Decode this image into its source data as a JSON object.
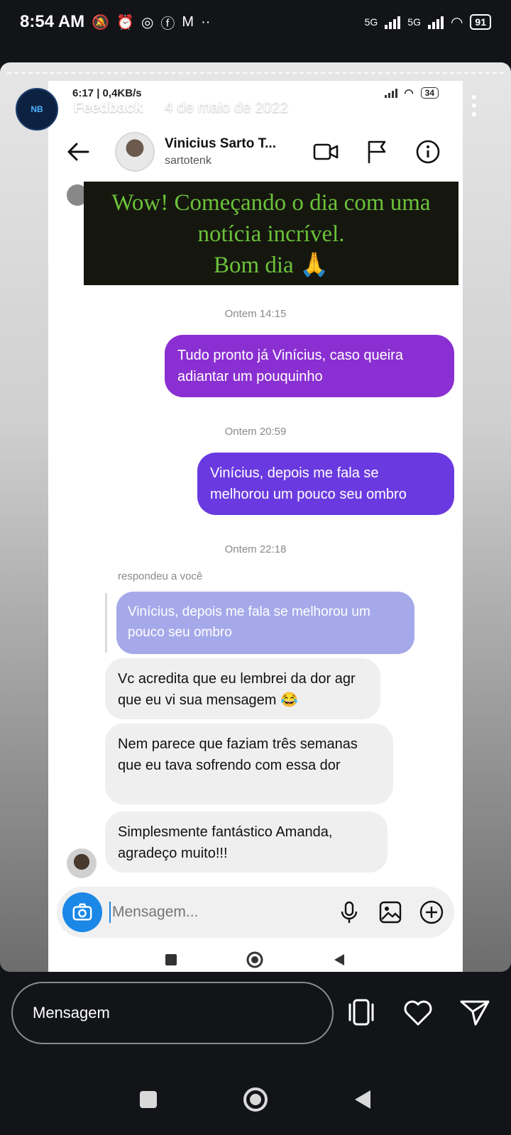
{
  "os_status": {
    "time": "8:54 AM",
    "net1": "5G",
    "net2": "5G",
    "battery": "91"
  },
  "story": {
    "username": "Feedback",
    "date": "4 de maio de 2022"
  },
  "inner_status": {
    "left": "6:17 | 0,4KB/s",
    "battery": "34"
  },
  "chat": {
    "contact_name": "Vinicius Sarto T...",
    "contact_handle": "sartotenk",
    "banner_lines": [
      "Wow! Começando o dia com uma",
      "notícia incrível.",
      "Bom dia 🙏"
    ],
    "timestamps": [
      "Ontem 14:15",
      "Ontem 20:59",
      "Ontem 22:18"
    ],
    "outgoing": [
      "Tudo pronto já Vinícius, caso queira adiantar um pouquinho",
      "Vinícius, depois me fala se melhorou um pouco seu ombro"
    ],
    "reply_label": "respondeu a você",
    "reply_quote": "Vinícius, depois me fala se melhorou um pouco seu ombro",
    "incoming": [
      "Vc acredita que eu lembrei da dor agr que eu vi sua mensagem 😂",
      "Nem parece que faziam três semanas que eu tava sofrendo com essa dor",
      "Simplesmente fantástico Amanda, agradeço muito!!!"
    ],
    "composer_placeholder": "Mensagem..."
  },
  "reply_bar": {
    "placeholder": "Mensagem"
  },
  "colors": {
    "outgoing_1": "#8a2fd1",
    "outgoing_2": "#6a3ae0",
    "reply_quote": "#a5a9ea",
    "banner_text": "#6cc23a",
    "camera_button": "#1b87e6"
  }
}
